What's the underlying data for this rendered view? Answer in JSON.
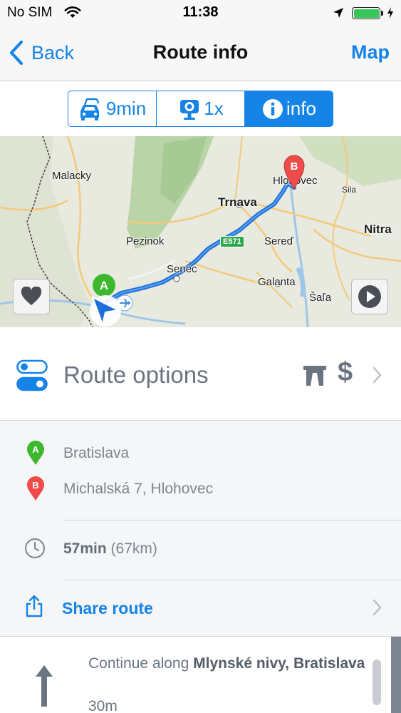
{
  "status_bar": {
    "carrier": "No SIM",
    "time": "11:38",
    "icons": [
      "wifi-icon",
      "location-arrow-icon",
      "battery-icon",
      "charging-bolt-icon"
    ],
    "battery_level": 1.0
  },
  "nav": {
    "back_label": "Back",
    "title": "Route info",
    "map_label": "Map"
  },
  "tabs": [
    {
      "label": "9min",
      "icon": "traffic-car-icon",
      "active": false
    },
    {
      "label": "1x",
      "icon": "speed-camera-icon",
      "active": false
    },
    {
      "label": "info",
      "icon": "info-icon",
      "active": true
    }
  ],
  "map": {
    "labels": [
      "Malacky",
      "Trnava",
      "Hlohovec",
      "Sila",
      "Nitra",
      "Pezinok",
      "Sereď",
      "Senec",
      "Galanta",
      "Šaľa"
    ],
    "road_badge": "E571",
    "start_marker": "A",
    "end_marker": "B",
    "route_color": "#1e6fd9",
    "buttons": [
      "heart-icon",
      "play-icon"
    ]
  },
  "route_options": {
    "label": "Route options",
    "icons": [
      "toggle-icon",
      "motorway-icon",
      "dollar-icon",
      "chevron-right-icon"
    ],
    "toll_symbol": "$"
  },
  "details": {
    "start_marker": "A",
    "end_marker": "B",
    "start_color": "#3db82e",
    "end_color": "#ef4b4b",
    "start": "Bratislava",
    "destination": "Michalská 7, Hlohovec",
    "duration": "57min",
    "distance": "(67km)",
    "share_label": "Share route"
  },
  "instruction": {
    "prefix": "Continue along",
    "street": "Mlynské nivy, Bratislava",
    "distance": "30m",
    "icon": "straight-arrow-icon"
  },
  "colors": {
    "accent": "#1584e6",
    "text_gray": "#7d8590"
  }
}
